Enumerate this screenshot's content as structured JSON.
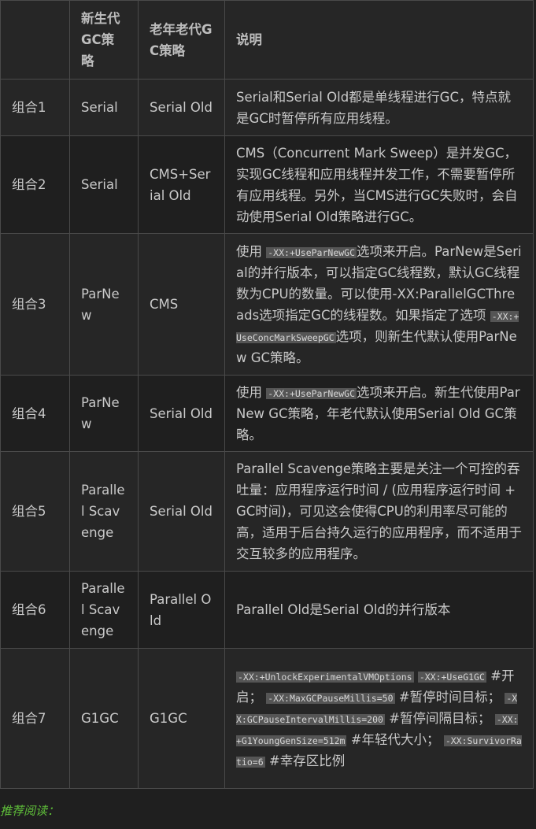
{
  "table": {
    "headers": {
      "col0": "",
      "col1": "新生代GC策略",
      "col2": "老年老代GC策略",
      "col3": "说明"
    },
    "rows": [
      {
        "combo": "组合1",
        "young": "Serial",
        "old": "Serial Old",
        "desc_parts": [
          "Serial和Serial Old都是单线程进行GC，特点就是GC时暂停所有应用线程。"
        ]
      },
      {
        "combo": "组合2",
        "young": "Serial",
        "old": "CMS+Serial Old",
        "desc_parts": [
          "CMS（Concurrent Mark Sweep）是并发GC，实现GC线程和应用线程并发工作，不需要暂停所有应用线程。另外，当CMS进行GC失败时，会自动使用Serial Old策略进行GC。"
        ]
      },
      {
        "combo": "组合3",
        "young": "ParNew",
        "old": "CMS",
        "desc_parts": [
          "使用",
          "-XX:+UseParNewGC",
          "选项来开启。ParNew是Serial的并行版本，可以指定GC线程数，默认GC线程数为CPU的数量。可以使用-XX:ParallelGCThreads选项指定GC的线程数。如果指定了选项",
          "-XX:+UseConcMarkSweepGC",
          "选项，则新生代默认使用ParNew GC策略。"
        ]
      },
      {
        "combo": "组合4",
        "young": "ParNew",
        "old": "Serial Old",
        "desc_parts": [
          "使用",
          "-XX:+UseParNewGC",
          "选项来开启。新生代使用ParNew GC策略，年老代默认使用Serial Old GC策略。"
        ]
      },
      {
        "combo": "组合5",
        "young": "Parallel Scavenge",
        "old": "Serial Old",
        "desc_parts": [
          "Parallel Scavenge策略主要是关注一个可控的吞吐量：应用程序运行时间 / (应用程序运行时间 + GC时间)，可见这会使得CPU的利用率尽可能的高，适用于后台持久运行的应用程序，而不适用于交互较多的应用程序。"
        ]
      },
      {
        "combo": "组合6",
        "young": "Parallel Scavenge",
        "old": "Parallel Old",
        "desc_parts": [
          "Parallel Old是Serial Old的并行版本"
        ]
      },
      {
        "combo": "组合7",
        "young": "G1GC",
        "old": "G1GC",
        "desc_parts": [
          "-XX:+UnlockExperimentalVMOptions",
          " ",
          "-XX:+UseG1GC",
          " #开启； ",
          "-XX:MaxGCPauseMillis=50",
          " #暂停时间目标； ",
          "-XX:GCPauseIntervalMillis=200",
          " #暂停间隔目标； ",
          "-XX:+G1YoungGenSize=512m",
          " #年轻代大小； ",
          "-XX:SurvivorRatio=6",
          " #幸存区比例"
        ]
      }
    ]
  },
  "footer": {
    "text": "推荐阅读："
  }
}
